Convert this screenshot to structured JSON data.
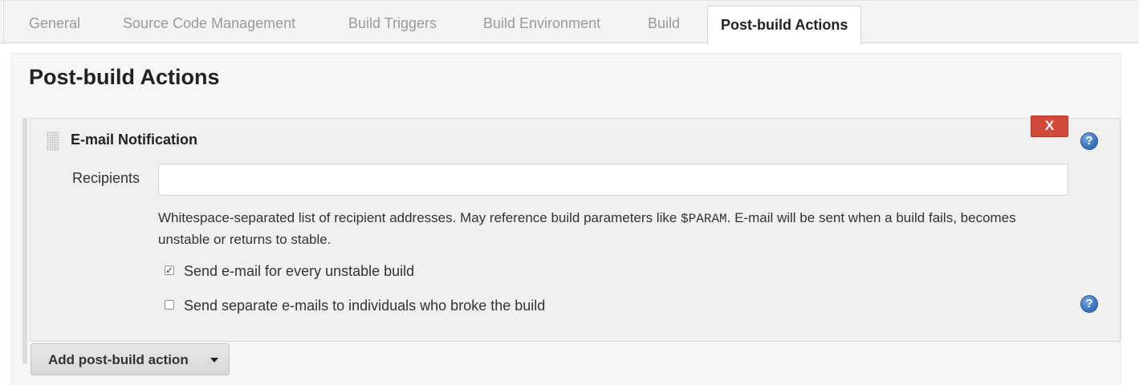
{
  "tabs": [
    {
      "label": "General"
    },
    {
      "label": "Source Code Management"
    },
    {
      "label": "Build Triggers"
    },
    {
      "label": "Build Environment"
    },
    {
      "label": "Build"
    },
    {
      "label": "Post-build Actions",
      "active": true
    }
  ],
  "section": {
    "title": "Post-build Actions"
  },
  "panel": {
    "title": "E-mail Notification",
    "delete_label": "X",
    "help_glyph": "?",
    "recipients": {
      "label": "Recipients",
      "value": "",
      "help_before": "Whitespace-separated list of recipient addresses. May reference build parameters like ",
      "help_code": "$PARAM",
      "help_after": ". E-mail will be sent when a build fails, becomes unstable or returns to stable."
    },
    "options": [
      {
        "label": "Send e-mail for every unstable build",
        "checked": true
      },
      {
        "label": "Send separate e-mails to individuals who broke the build",
        "checked": false
      }
    ]
  },
  "add_action_button": {
    "label": "Add post-build action"
  },
  "colors": {
    "delete_button": "#d24939",
    "help_icon": "#3f79c2",
    "tabbar_bg": "#f3f3f3",
    "panel_bg": "#f0f0f0"
  },
  "icons": {
    "drag_handle": "drag-handle-icon",
    "help": "help-icon",
    "dropdown": "chevron-down-icon",
    "check": "checkmark-icon"
  }
}
